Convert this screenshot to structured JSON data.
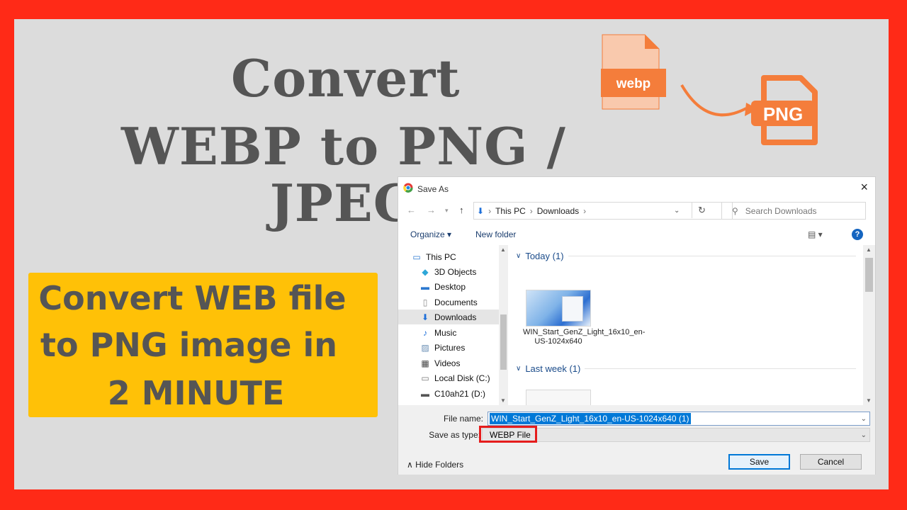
{
  "headline": {
    "line1": "Convert",
    "line2": "WEBP to PNG / JPEG"
  },
  "callout": {
    "line1": "Convert WEB file",
    "line2": "to PNG image in",
    "line3": "2 MINUTE"
  },
  "badges": {
    "webp": "webp",
    "png": "PNG"
  },
  "colors": {
    "border_red": "#ff2a17",
    "callout_yellow": "#ffc107",
    "icon_orange": "#f47d3b",
    "highlight_red": "#e51c1c",
    "accent_blue": "#0078d7"
  },
  "dialog": {
    "title": "Save As",
    "close": "×",
    "breadcrumb": [
      "This PC",
      "Downloads"
    ],
    "search_placeholder": "Search Downloads",
    "toolbar": {
      "organize": "Organize",
      "new_folder": "New folder",
      "help": "?"
    },
    "nav_items": [
      {
        "label": "This PC",
        "icon": "pc-icon"
      },
      {
        "label": "3D Objects",
        "icon": "cube-icon"
      },
      {
        "label": "Desktop",
        "icon": "desktop-icon"
      },
      {
        "label": "Documents",
        "icon": "document-icon"
      },
      {
        "label": "Downloads",
        "icon": "download-icon",
        "selected": true
      },
      {
        "label": "Music",
        "icon": "music-icon"
      },
      {
        "label": "Pictures",
        "icon": "picture-icon"
      },
      {
        "label": "Videos",
        "icon": "video-icon"
      },
      {
        "label": "Local Disk (C:)",
        "icon": "disk-icon"
      },
      {
        "label": "C10ah21 (D:)",
        "icon": "drive-icon"
      }
    ],
    "groups": [
      {
        "title": "Today (1)",
        "files": [
          "WIN_Start_GenZ_Light_16x10_en-US-1024x640"
        ]
      },
      {
        "title": "Last week (1)"
      }
    ],
    "file_name_label": "File name:",
    "file_name_value": "WIN_Start_GenZ_Light_16x10_en-US-1024x640 (1)",
    "save_type_label": "Save as type:",
    "save_type_value": "WEBP File",
    "hide_folders": "Hide Folders",
    "save_button": "Save",
    "cancel_button": "Cancel"
  }
}
